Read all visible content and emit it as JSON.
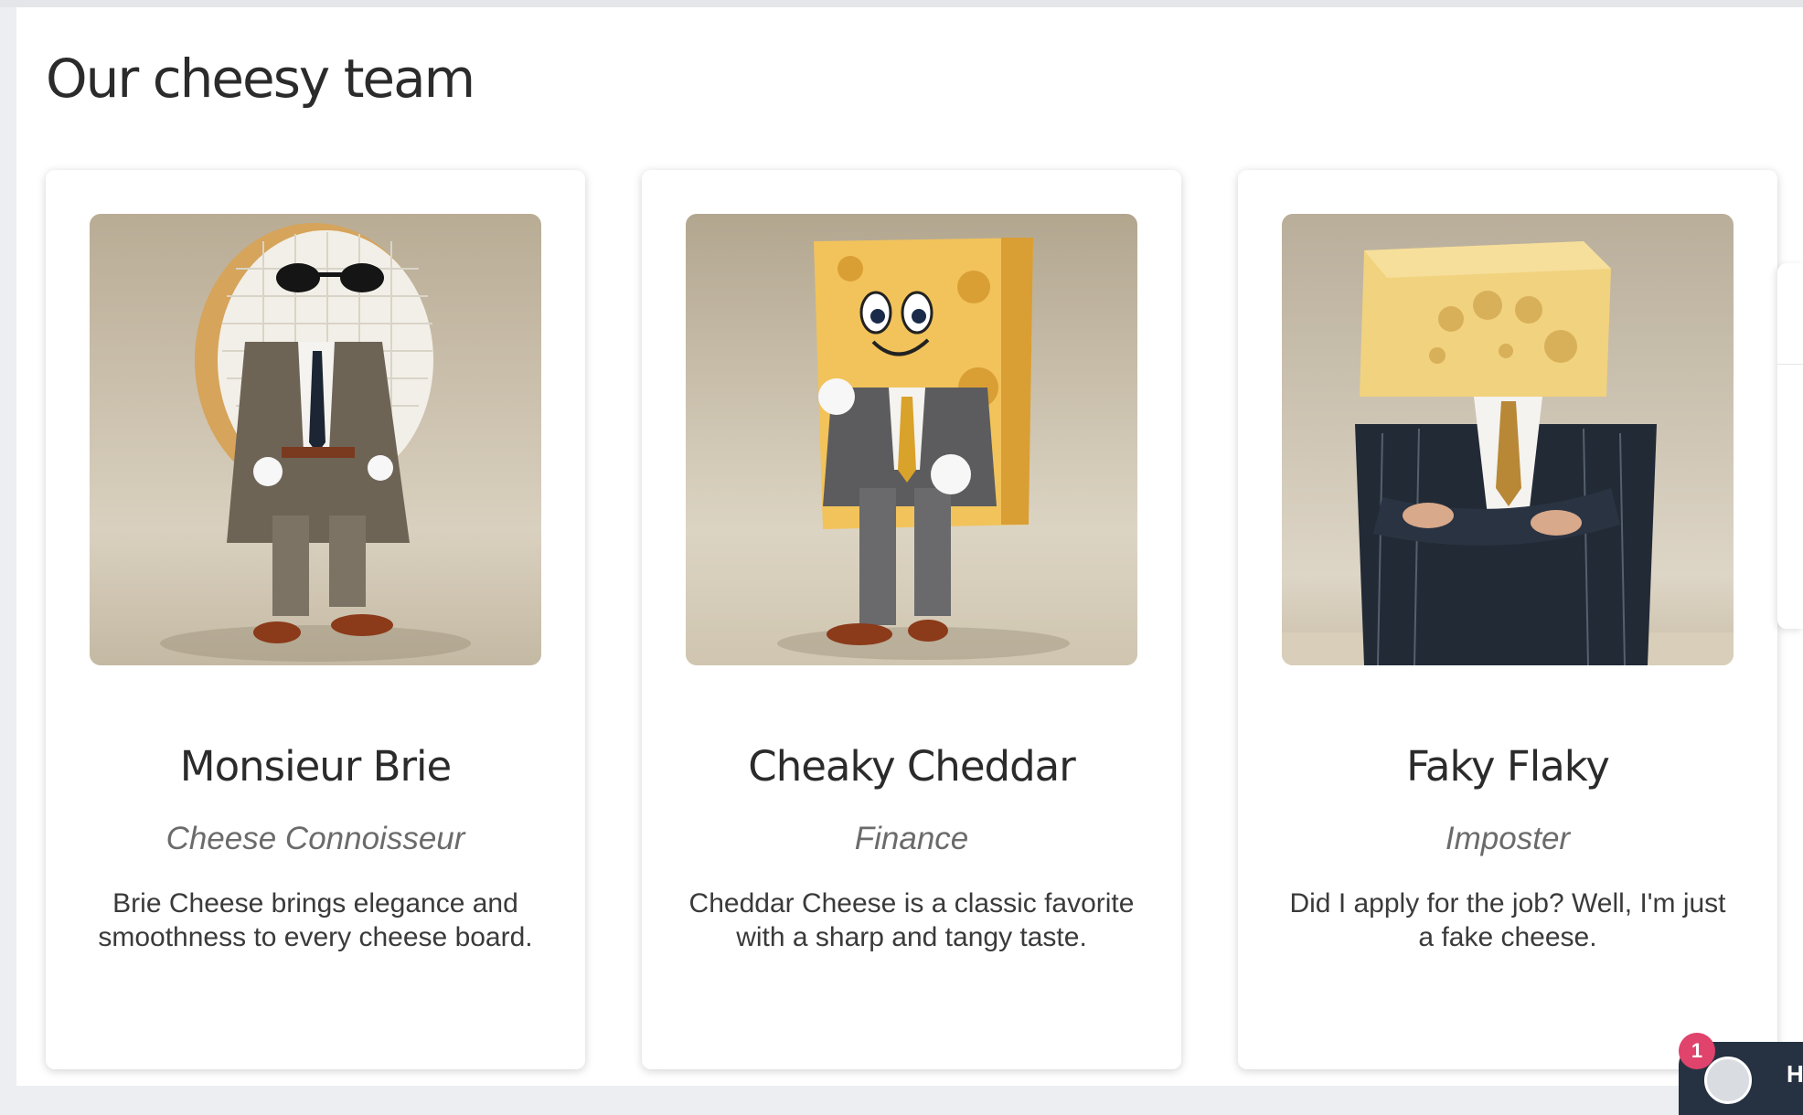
{
  "page": {
    "title": "Our cheesy team"
  },
  "team": [
    {
      "name": "Monsieur Brie",
      "role": "Cheese Connoisseur",
      "bio": "Brie Cheese brings elegance and smoothness to every cheese board.",
      "image": "brie-character-photo"
    },
    {
      "name": "Cheaky Cheddar",
      "role": "Finance",
      "bio": "Cheddar Cheese is a classic favorite with a sharp and tangy taste.",
      "image": "cheddar-character-photo"
    },
    {
      "name": "Faky Flaky",
      "role": "Imposter",
      "bio": "Did I apply for the job? Well, I'm just a fake cheese.",
      "image": "fake-cheese-character-photo"
    }
  ],
  "chat": {
    "unread_count": "1",
    "label": "H"
  },
  "colors": {
    "background": "#ffffff",
    "text": "#2b2b2b",
    "role_text": "#6b6b6b",
    "badge": "#e0436b",
    "chat_launcher": "#263241"
  }
}
